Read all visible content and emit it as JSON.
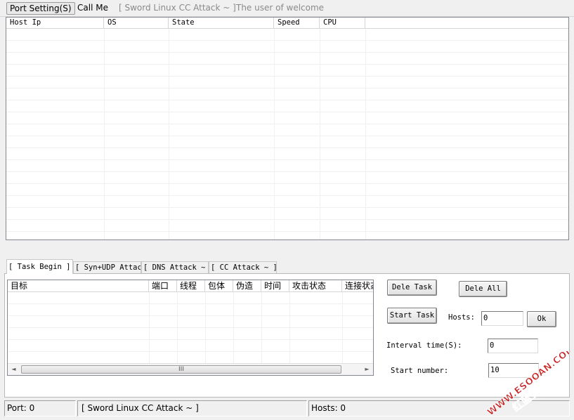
{
  "menu": {
    "port_setting": "Port Setting(S)",
    "call_me": "Call Me",
    "title_text": "[ Sword Linux CC Attack ~ ]",
    "welcome": "The user of welcome"
  },
  "host_table": {
    "columns": [
      "Host Ip",
      "OS",
      "State",
      "Speed",
      "CPU"
    ]
  },
  "tabs": [
    "[ Task Begin ]",
    "[ Syn+UDP Attack ~ ]",
    "[ DNS Attack ~ ]",
    "[ CC  Attack ~ ]"
  ],
  "task_table": {
    "columns": [
      "目标",
      "端口",
      "线程",
      "包体",
      "伪造",
      "时间",
      "攻击状态",
      "连接状态"
    ],
    "scroll_left": "◄",
    "scroll_right": "►",
    "scroll_grip": "III"
  },
  "controls": {
    "dele_task": "Dele Task",
    "dele_all": "Dele All",
    "start_task": "Start Task",
    "hosts_label": "Hosts:",
    "hosts_value": "0",
    "ok": "Ok",
    "interval_label": "Interval time(S):",
    "interval_value": "0",
    "start_number_label": "Start number:",
    "start_number_value": "10"
  },
  "status": {
    "port": "Port: 0",
    "attack": "[ Sword Linux CC Attack ~ ]",
    "hosts": "Hosts: 0"
  },
  "watermark": {
    "url": "WWW.ESOOAN.COM",
    "brand": "红蓝安全网",
    "color": "#c81e1e"
  }
}
